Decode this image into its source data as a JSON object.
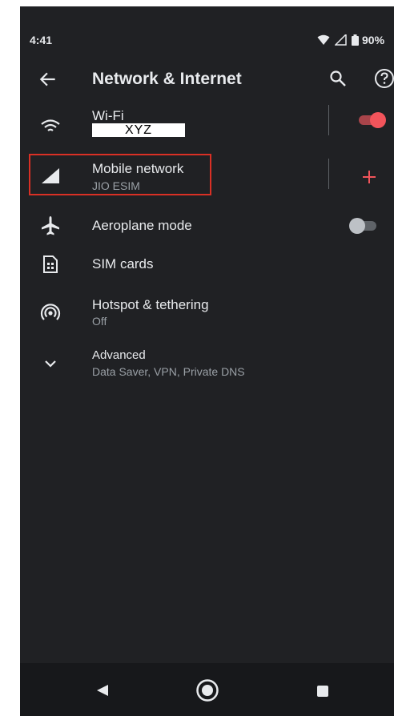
{
  "status_bar": {
    "time": "4:41",
    "battery": "90%"
  },
  "toolbar": {
    "title": "Network & Internet"
  },
  "settings": {
    "wifi": {
      "title": "Wi-Fi",
      "ssid": "XYZ",
      "enabled": true
    },
    "mobile": {
      "title": "Mobile network",
      "subtitle": "JIO ESIM"
    },
    "aeroplane": {
      "title": "Aeroplane mode",
      "enabled": false
    },
    "sim": {
      "title": "SIM cards"
    },
    "hotspot": {
      "title": "Hotspot & tethering",
      "subtitle": "Off"
    },
    "advanced": {
      "title": "Advanced",
      "subtitle": "Data Saver, VPN, Private DNS"
    }
  },
  "colors": {
    "background": "#202124",
    "accent": "#f2545b",
    "highlight": "#d93025",
    "text_primary": "#e8eaed",
    "text_secondary": "#9aa0a6"
  },
  "icons": {
    "back": "arrow-left-icon",
    "search": "search-icon",
    "help": "help-icon",
    "wifi": "wifi-icon",
    "mobile": "cell-signal-icon",
    "aeroplane": "airplane-icon",
    "sim": "sim-card-icon",
    "hotspot": "hotspot-icon",
    "advanced": "chevron-down-icon"
  }
}
